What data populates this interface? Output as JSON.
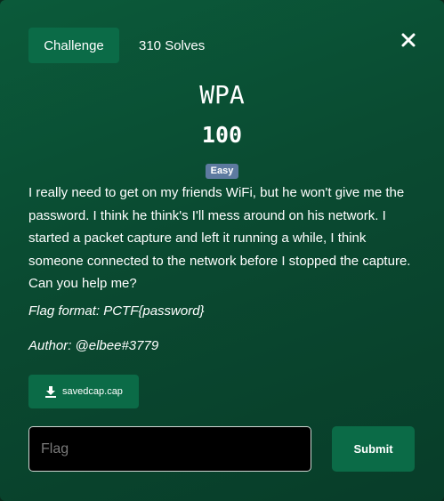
{
  "tabs": {
    "challenge_label": "Challenge",
    "solves_label": "310 Solves"
  },
  "challenge": {
    "name": "WPA",
    "points": "100",
    "difficulty": "Easy",
    "description": "I really need to get on my friends WiFi, but he won't give me the password. I think he think's I'll mess around on his network. I started a packet capture and left it running a while, I think someone connected to the network before I stopped the capture. Can you help me?",
    "flag_format": "Flag format: PCTF{password}",
    "author": "Author: @elbee#3779"
  },
  "file": {
    "name": "savedcap.cap",
    "icon": "download-icon"
  },
  "form": {
    "flag_placeholder": "Flag",
    "flag_value": "",
    "submit_label": "Submit"
  },
  "colors": {
    "accent": "#0b6b47",
    "badge": "#5d7aa0"
  }
}
